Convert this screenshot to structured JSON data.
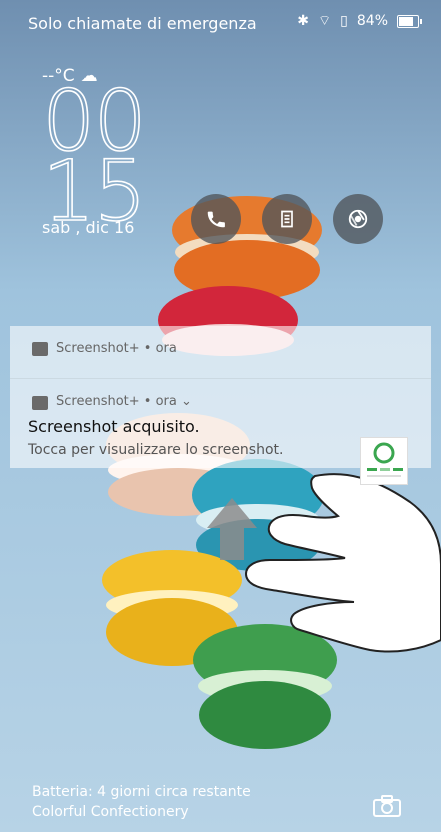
{
  "status_bar": {
    "carrier_text": "Solo chiamate di emergenza",
    "battery_percent": "84%",
    "battery_level": 0.84,
    "icons": [
      "bluetooth-icon",
      "wifi-icon",
      "sim-icon",
      "battery-icon"
    ]
  },
  "lockscreen": {
    "weather_temp": "--°C",
    "weather_icon": "cloud-icon",
    "clock_hours": "00",
    "clock_minutes": "15",
    "date": "sab , dic 16",
    "shortcuts": [
      {
        "name": "phone-shortcut",
        "icon": "phone-icon"
      },
      {
        "name": "notes-shortcut",
        "icon": "notes-icon"
      },
      {
        "name": "chrome-shortcut",
        "icon": "chrome-icon"
      }
    ]
  },
  "notifications": [
    {
      "app_line": "Screenshot+ • ora"
    },
    {
      "app_line": "Screenshot+ • ora ⌄",
      "title": "Screenshot acquisito.",
      "text": "Tocca per visualizzare lo screenshot."
    }
  ],
  "bottom": {
    "battery_info": "Batteria: 4 giorni circa restante",
    "theme_name": "Colorful Confectionery",
    "camera_icon": "camera-icon"
  }
}
